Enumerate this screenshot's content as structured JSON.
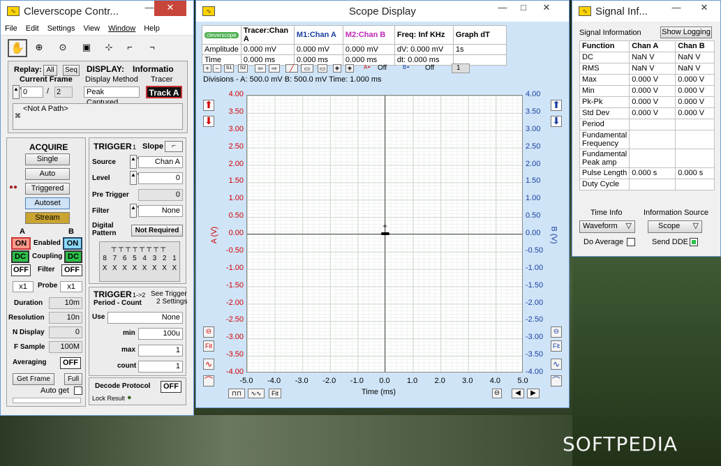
{
  "desktop": {
    "watermark": "SOFTPEDIA"
  },
  "control": {
    "title": "Cleverscope Contr...",
    "menu": [
      "File",
      "Edit",
      "Settings",
      "View",
      "Window",
      "Help"
    ],
    "replay_label": "Replay:",
    "replay_all": "All",
    "replay_seq": "Seq",
    "current_frame_label": "Current Frame",
    "current_frame": "0",
    "frame_sep": "/",
    "frame_total": "2",
    "display_label": "DISPLAY:",
    "info_label": "Informatio",
    "display_method_label": "Display Method",
    "display_method": "Peak Captured",
    "tracer_label": "Tracer",
    "tracer_value": "Track A",
    "path": "<Not A Path>",
    "acquire": "ACQUIRE",
    "single": "Single",
    "auto": "Auto",
    "triggered": "Triggered",
    "autoset": "Autoset",
    "stream": "Stream",
    "chan_a": "A",
    "chan_b": "B",
    "enabled_label": "Enabled",
    "enabled_a": "ON",
    "enabled_b": "ON",
    "coupling_label": "Coupling",
    "coupling_a": "DC",
    "coupling_b": "DC",
    "filter_label": "Filter",
    "filter_a": "OFF",
    "filter_b": "OFF",
    "probe_label": "Probe",
    "probe_a": "x1",
    "probe_b": "x1",
    "duration_label": "Duration",
    "duration": "10m",
    "resolution_label": "Resolution",
    "resolution": "10n",
    "ndisplay_label": "N Display",
    "ndisplay": "0",
    "fsample_label": "F Sample",
    "fsample": "100M",
    "averaging_label": "Averaging",
    "averaging": "OFF",
    "get_frame": "Get Frame",
    "full": "Full",
    "auto_get": "Auto get",
    "trigger1_title": "TRIGGER",
    "trigger1_sub": "1",
    "slope_label": "Slope",
    "source_label": "Source",
    "source": "Chan A",
    "level_label": "Level",
    "level": "0",
    "pretrigger_label": "Pre Trigger",
    "pretrigger": "0",
    "filter2_label": "Filter",
    "filter2": "None",
    "digital_label": "Digital",
    "pattern_label": "Pattern",
    "not_required": "Not Required",
    "bits": [
      "8",
      "7",
      "6",
      "5",
      "4",
      "3",
      "2",
      "1"
    ],
    "bitx": [
      "X",
      "X",
      "X",
      "X",
      "X",
      "X",
      "X",
      "X"
    ],
    "trigger2_title": "TRIGGER",
    "trigger2_sub": "1->2",
    "see_trigger": "See Trigger",
    "settings2": "2 Settings",
    "period_count": "Period - Count",
    "use_label": "Use",
    "use": "None",
    "min_label": "min",
    "min": "100u",
    "max_label": "max",
    "max": "1",
    "count_label": "count",
    "count": "1",
    "decode_label": "Decode Protocol",
    "decode": "OFF",
    "lock_result": "Lock Result"
  },
  "scope": {
    "title": "Scope Display",
    "hdr_cols": [
      "Tracer:Chan A",
      "M1:Chan A",
      "M2:Chan B",
      "Freq: Inf KHz",
      "Graph dT"
    ],
    "amp_label": "Amplitude",
    "time_label": "Time",
    "amp_vals": [
      "0.000 mV",
      "0.000 mV",
      "0.000 mV",
      "dV: 0.000 mV",
      "1s"
    ],
    "time_vals": [
      "0.000 ms",
      "0.000 ms",
      "0.000 ms",
      "dt:  0.000 ms",
      ""
    ],
    "tb_off1": "Off",
    "tb_off2": "Off",
    "tb_num": "1",
    "divisions": "Divisions -  A: 500.0 mV    B: 500.0 mV    Time: 1.000 ms",
    "ylabel_left": "A (V)",
    "ylabel_right": "B (V)",
    "xlabel": "Time (ms)",
    "fit": "Fit",
    "yticks": [
      "4.00",
      "3.50",
      "3.00",
      "2.50",
      "2.00",
      "1.50",
      "1.00",
      "0.50",
      "0.00",
      "-0.50",
      "-1.00",
      "-1.50",
      "-2.00",
      "-2.50",
      "-3.00",
      "-3.50",
      "-4.00"
    ],
    "xticks": [
      "-5.0",
      "-4.0",
      "-3.0",
      "-2.0",
      "-1.0",
      "0.0",
      "1.0",
      "2.0",
      "3.0",
      "4.0",
      "5.0"
    ]
  },
  "signal": {
    "title": "Signal Inf...",
    "info_label": "Signal Information",
    "show_logging": "Show Logging",
    "headers": [
      "Function",
      "Chan A",
      "Chan B"
    ],
    "rows": [
      [
        "DC",
        "NaN V",
        "NaN V"
      ],
      [
        "RMS",
        "NaN V",
        "NaN V"
      ],
      [
        "Max",
        "0.000 V",
        "0.000 V"
      ],
      [
        "Min",
        "0.000 V",
        "0.000 V"
      ],
      [
        "Pk-Pk",
        "0.000 V",
        "0.000 V"
      ],
      [
        "Std Dev",
        "0.000 V",
        "0.000 V"
      ],
      [
        "Period",
        "",
        ""
      ],
      [
        "Fundamental Frequency",
        "",
        ""
      ],
      [
        "Fundamental Peak amp",
        "",
        ""
      ],
      [
        "Pulse Length",
        "0.000 s",
        "0.000 s"
      ],
      [
        "Duty Cycle",
        "",
        ""
      ]
    ],
    "time_info": "Time Info",
    "info_source": "Information Source",
    "waveform": "Waveform",
    "scope": "Scope",
    "do_average": "Do Average",
    "send_dde": "Send DDE"
  }
}
